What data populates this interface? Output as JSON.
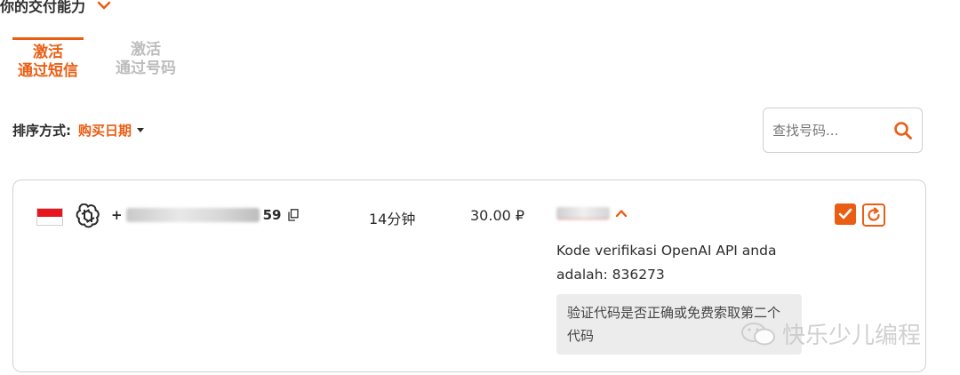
{
  "section": {
    "title": "你的交付能力",
    "toggle_icon": "chevron-down-icon"
  },
  "tabs": [
    {
      "line1": "激活",
      "line2": "通过短信",
      "active": true
    },
    {
      "line1": "激活",
      "line2": "通过号码",
      "active": false
    }
  ],
  "sort": {
    "label": "排序方式:",
    "value": "购买日期"
  },
  "search": {
    "placeholder": "查找号码..."
  },
  "order": {
    "phone_prefix": "+",
    "phone_suffix": "59",
    "duration": "14分钟",
    "price": "30.00 ₽",
    "sms_text": "Kode verifikasi OpenAI API anda adalah: 836273",
    "hint": "验证代码是否正确或免费索取第二个代码"
  },
  "watermark": {
    "text": "快乐少儿编程"
  },
  "colors": {
    "accent": "#ea5e14",
    "flag_red": "#e8141e",
    "hint_bg": "#ececec"
  }
}
